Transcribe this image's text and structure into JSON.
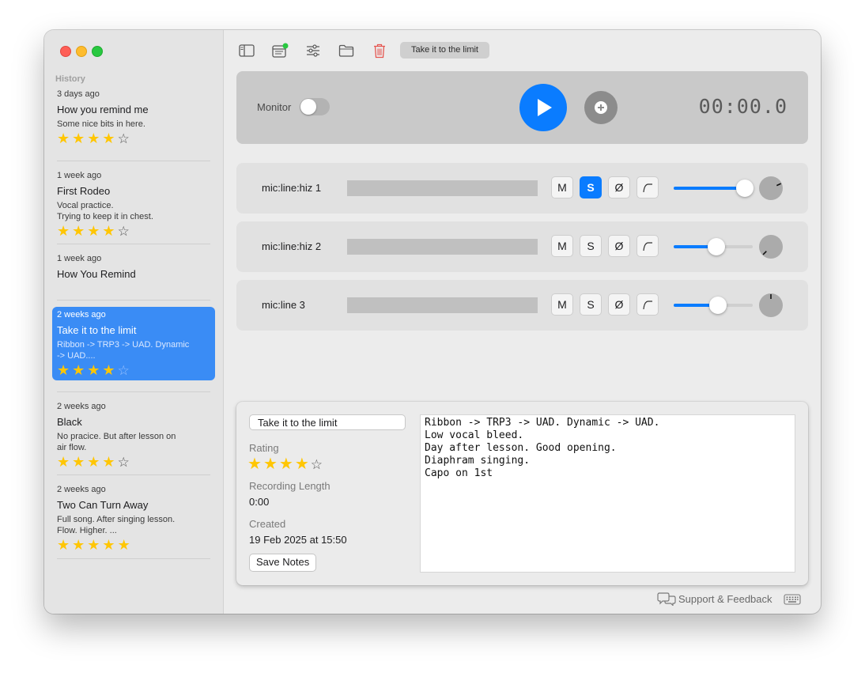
{
  "sidebar": {
    "section_label": "History",
    "items": [
      {
        "date": "3 days ago",
        "title": "How you remind me",
        "desc": "Some nice bits in here.",
        "rating": 4,
        "selected": false
      },
      {
        "date": "1 week ago",
        "title": "First Rodeo",
        "desc": "Vocal practice.\nTrying to keep it in chest.",
        "rating": 4,
        "selected": false
      },
      {
        "date": "1 week ago",
        "title": "How You Remind",
        "desc": "",
        "rating": 0,
        "selected": false
      },
      {
        "date": "2 weeks ago",
        "title": "Take it to the limit",
        "desc": "Ribbon -> TRP3 -> UAD. Dynamic\n-> UAD....",
        "rating": 4,
        "selected": true
      },
      {
        "date": "2 weeks ago",
        "title": "Black",
        "desc": "No pracice. But after lesson on\nair flow.",
        "rating": 4,
        "selected": false
      },
      {
        "date": "2 weeks ago",
        "title": "Two Can Turn Away",
        "desc": "Full song. After singing lesson.\nFlow. Higher. ...",
        "rating": 5,
        "selected": false
      }
    ]
  },
  "toolbar": {
    "current_title": "Take it to the limit",
    "icons": [
      "sidebar-toggle-icon",
      "notes-icon",
      "sliders-icon",
      "folder-icon",
      "trash-icon"
    ],
    "notes_badge_color": "#28c840",
    "trash_color": "#e5554f"
  },
  "transport": {
    "monitor_label": "Monitor",
    "monitor_on": false,
    "timer": "00:00.0",
    "accent": "#0a7cff"
  },
  "tracks": [
    {
      "name": "mic:line:hiz 1",
      "mute": "M",
      "solo": "S",
      "solo_active": true,
      "phase": "Ø",
      "volume": 0.9,
      "pan_angle": 65
    },
    {
      "name": "mic:line:hiz 2",
      "mute": "M",
      "solo": "S",
      "solo_active": false,
      "phase": "Ø",
      "volume": 0.54,
      "pan_angle": 225
    },
    {
      "name": "mic:line 3",
      "mute": "M",
      "solo": "S",
      "solo_active": false,
      "phase": "Ø",
      "volume": 0.56,
      "pan_angle": 0
    }
  ],
  "details": {
    "name_value": "Take it to the limit",
    "rating_label": "Rating",
    "rating": 4,
    "length_label": "Recording Length",
    "length_value": "0:00",
    "created_label": "Created",
    "created_value": "19 Feb 2025 at 15:50",
    "save_label": "Save Notes",
    "notes": "Ribbon -> TRP3 -> UAD. Dynamic -> UAD.\nLow vocal bleed.\nDay after lesson. Good opening.\nDiaphram singing.\nCapo on 1st"
  },
  "footer": {
    "support_label": "Support & Feedback"
  }
}
